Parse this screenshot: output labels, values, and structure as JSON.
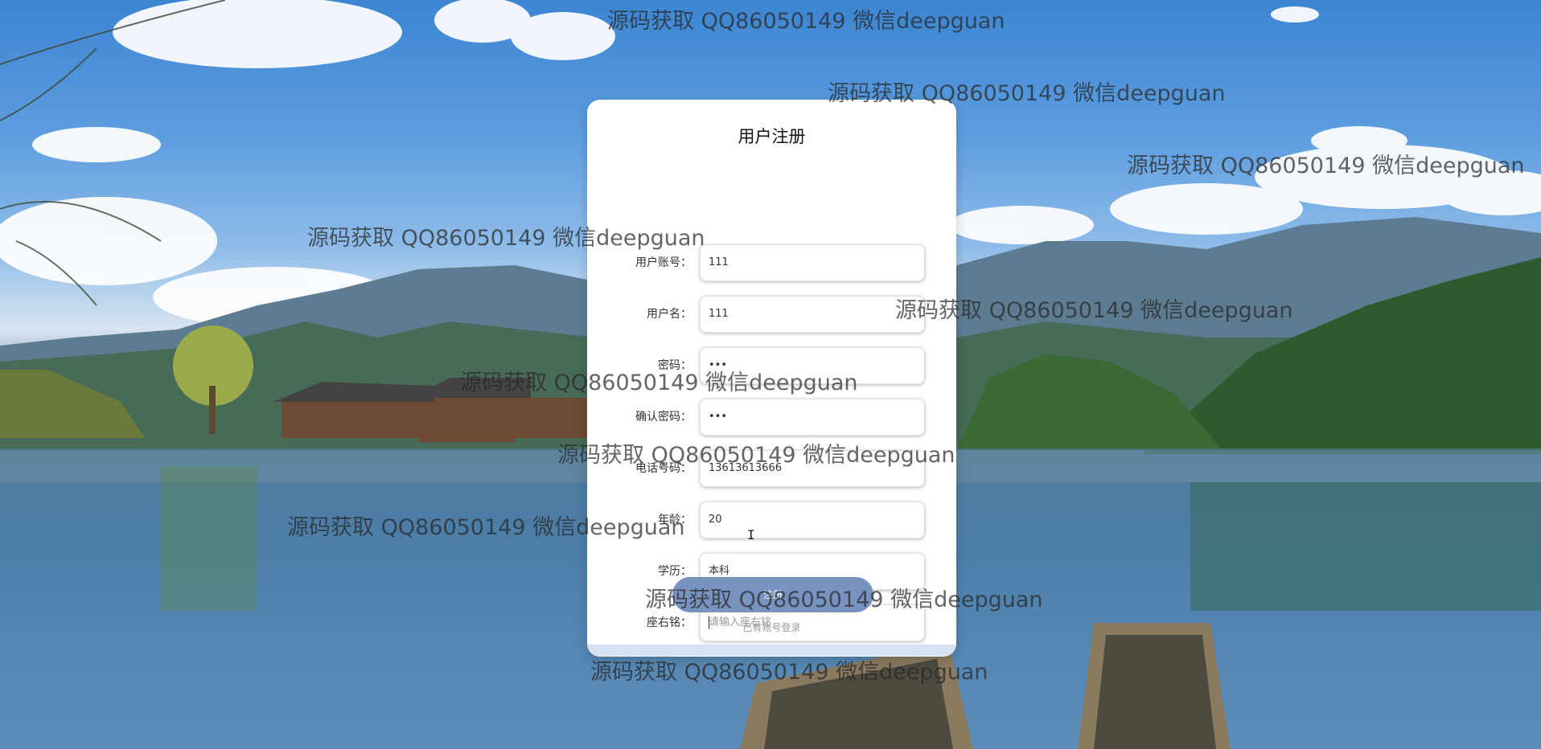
{
  "form": {
    "title": "用户注册",
    "fields": [
      {
        "label": "用户账号：",
        "value": "111",
        "placeholder": ""
      },
      {
        "label": "用户名：",
        "value": "111",
        "placeholder": ""
      },
      {
        "label": "密码：",
        "value": "•••",
        "placeholder": ""
      },
      {
        "label": "确认密码：",
        "value": "•••",
        "placeholder": ""
      },
      {
        "label": "电话号码：",
        "value": "13613613666",
        "placeholder": ""
      },
      {
        "label": "年龄：",
        "value": "20",
        "placeholder": ""
      },
      {
        "label": "学历：",
        "value": "本科",
        "placeholder": ""
      },
      {
        "label": "座右铭：",
        "value": "",
        "placeholder": "请输入座右铭"
      }
    ],
    "register_button": "注册",
    "login_link": "已有账号登录"
  },
  "watermarks": [
    "源码获取 QQ86050149 微信deepguan",
    "源码获取 QQ86050149 微信deepguan",
    "源码获取 QQ86050149 微信deepguan",
    "源码获取 QQ86050149 微信deepguan",
    "源码获取 QQ86050149 微信deepguan",
    "源码获取 QQ86050149 微信deepguan",
    "源码获取 QQ86050149 微信deepguan",
    "源码获取 QQ86050149 微信deepguan",
    "源码获取 QQ86050149 微信deepguan",
    "源码获取 QQ86050149 微信deepguan"
  ]
}
